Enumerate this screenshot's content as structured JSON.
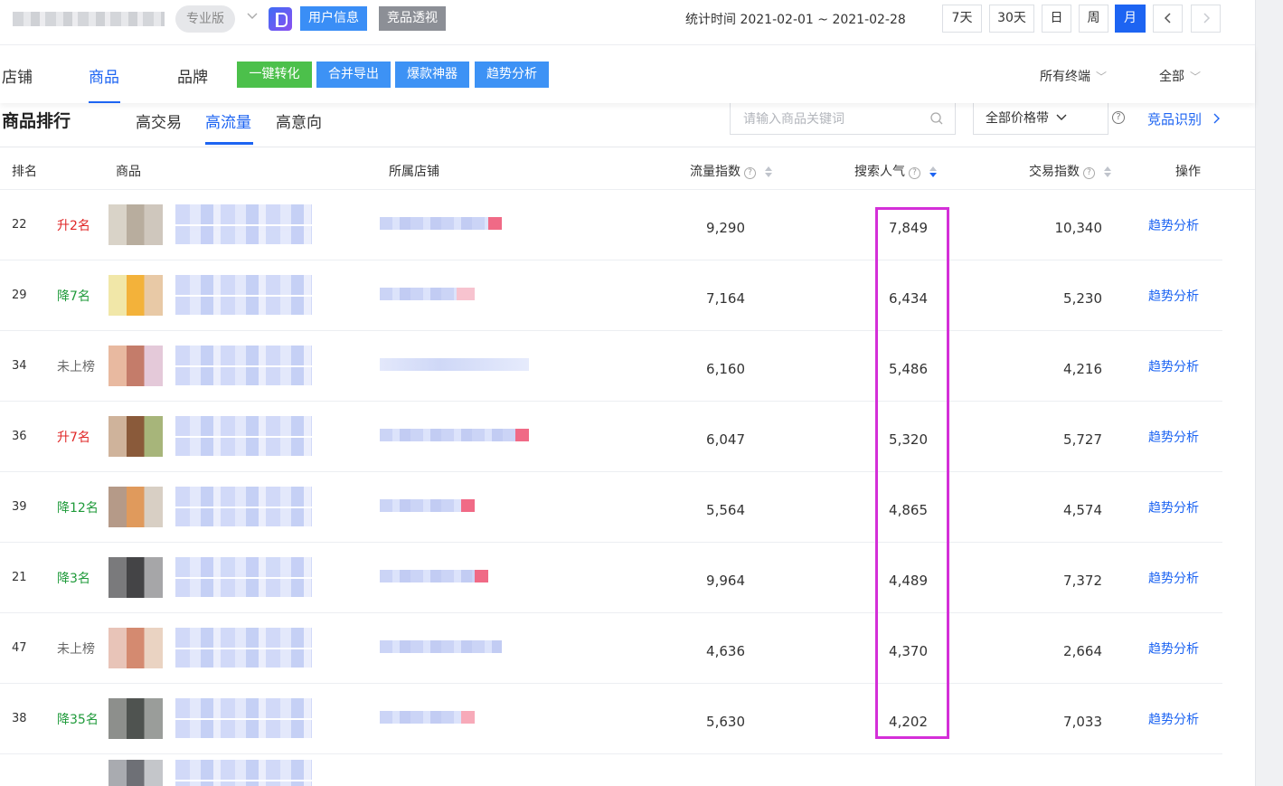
{
  "topbar": {
    "version": "专业版",
    "btn_user_info": "用户信息",
    "btn_competitor_view": "竞品透视",
    "stat_time": "统计时间 2021-02-01 ~ 2021-02-28",
    "periods": [
      "7天",
      "30天",
      "日",
      "周",
      "月"
    ],
    "active_period": "月"
  },
  "nav": {
    "tabs": [
      "店铺",
      "商品",
      "品牌"
    ],
    "active_tab": "商品",
    "tools": [
      "一键转化",
      "合并导出",
      "爆款神器",
      "趋势分析"
    ],
    "terminal_filter": "所有终端",
    "scope_filter": "全部"
  },
  "section": {
    "title": "商品排行",
    "sub_tabs": [
      "高交易",
      "高流量",
      "高意向"
    ],
    "active_sub_tab": "高流量",
    "search_placeholder": "请输入商品关键词",
    "price_filter": "全部价格带",
    "competitor_link": "竞品识别"
  },
  "table": {
    "headers": {
      "rank": "排名",
      "product": "商品",
      "shop": "所属店铺",
      "traffic": "流量指数",
      "search_pop": "搜索人气",
      "trade": "交易指数",
      "action": "操作"
    },
    "rows": [
      {
        "rank": "22",
        "change": "升2名",
        "dir": "up",
        "traffic": "9,290",
        "search": "7,849",
        "trade": "10,340",
        "action": "趋势分析"
      },
      {
        "rank": "29",
        "change": "降7名",
        "dir": "down",
        "traffic": "7,164",
        "search": "6,434",
        "trade": "5,230",
        "action": "趋势分析"
      },
      {
        "rank": "34",
        "change": "未上榜",
        "dir": "none",
        "traffic": "6,160",
        "search": "5,486",
        "trade": "4,216",
        "action": "趋势分析"
      },
      {
        "rank": "36",
        "change": "升7名",
        "dir": "up",
        "traffic": "6,047",
        "search": "5,320",
        "trade": "5,727",
        "action": "趋势分析"
      },
      {
        "rank": "39",
        "change": "降12名",
        "dir": "down",
        "traffic": "5,564",
        "search": "4,865",
        "trade": "4,574",
        "action": "趋势分析"
      },
      {
        "rank": "21",
        "change": "降3名",
        "dir": "down",
        "traffic": "9,964",
        "search": "4,489",
        "trade": "7,372",
        "action": "趋势分析"
      },
      {
        "rank": "47",
        "change": "未上榜",
        "dir": "none",
        "traffic": "4,636",
        "search": "4,370",
        "trade": "2,664",
        "action": "趋势分析"
      },
      {
        "rank": "38",
        "change": "降35名",
        "dir": "down",
        "traffic": "5,630",
        "search": "4,202",
        "trade": "7,033",
        "action": "趋势分析"
      }
    ]
  },
  "colors": {
    "accent": "#1d64f2",
    "up": "#e02727",
    "down": "#1f9a3a",
    "highlight": "#d42fd8"
  }
}
